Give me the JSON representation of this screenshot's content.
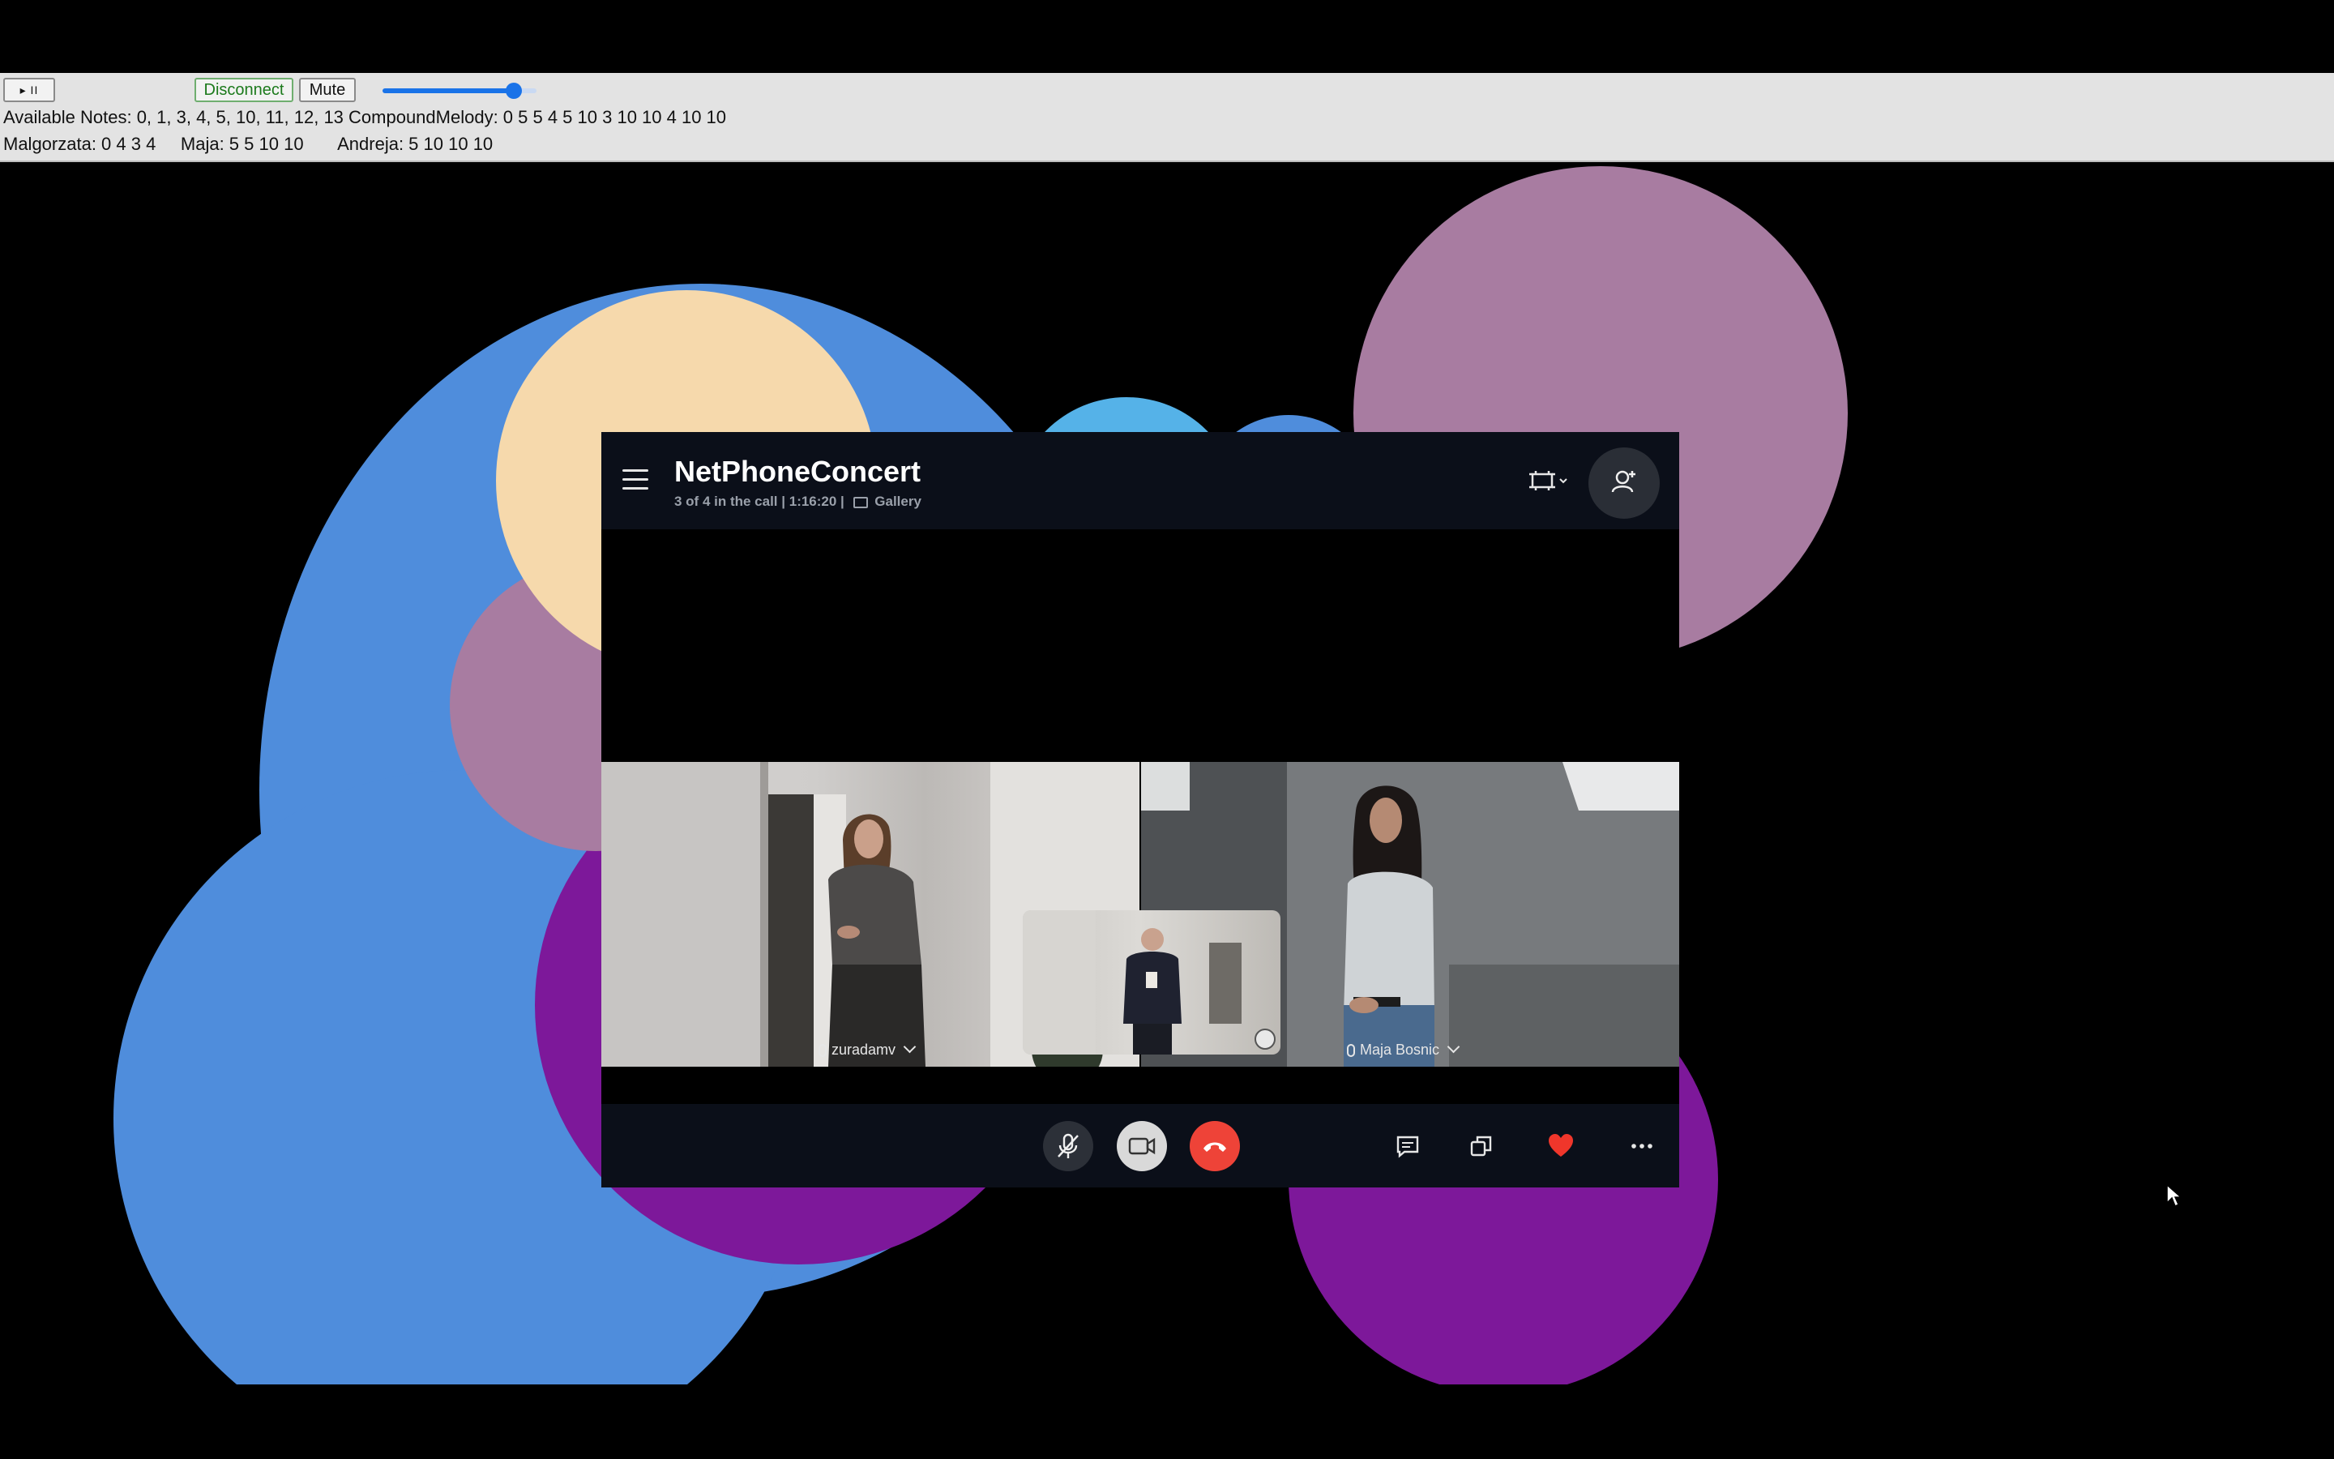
{
  "controls": {
    "play_pause_label": "▸ II",
    "disconnect_label": "Disconnect",
    "mute_label": "Mute",
    "volume_level": 0.85,
    "notes_line": "Available Notes: 0, 1, 3, 4, 5, 10, 11, 12, 13 CompoundMelody: 0 5 5 4 5 10 3 10 10 4 10 10",
    "players_line": "Malgorzata: 0 4 3 4     Maja: 5 5 10 10       Andreja: 5 10 10 10"
  },
  "call": {
    "title": "NetPhoneConcert",
    "status": "3 of 4 in the call | 1:16:20 |",
    "view_mode": "Gallery",
    "participants": [
      {
        "name": "zuradamv"
      },
      {
        "name": "Maja Bosnic"
      }
    ],
    "toolbar_icons": [
      "mic-muted-icon",
      "camera-icon",
      "hangup-icon",
      "chat-icon",
      "share-screen-icon",
      "heart-icon",
      "more-icon"
    ]
  },
  "colors": {
    "blue_blob": "#4f8ddc",
    "purple_blob": "#7d189a",
    "mauve_blob": "#a87ca1",
    "peach_blob": "#f6d9ac",
    "light_blue_blob": "#55b2e8",
    "hangup_red": "#ee4338",
    "heart_red": "#f0362b",
    "accent_blue": "#1a73e8"
  }
}
